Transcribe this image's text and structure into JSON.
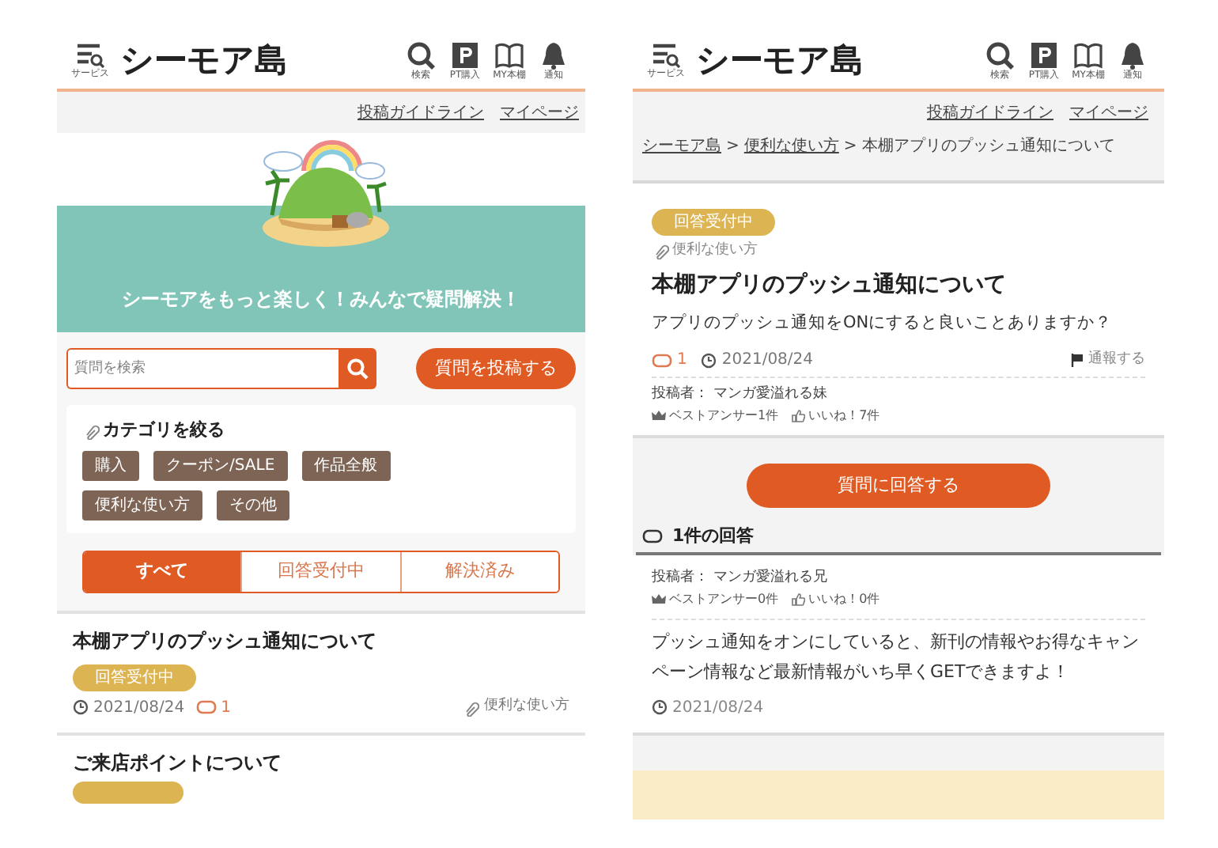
{
  "list_screen": {
    "header": {
      "service_label": "サービス",
      "logo": "シーモア島",
      "nav": [
        {
          "kind": "search",
          "label": "検索"
        },
        {
          "kind": "point",
          "label": "PT購入"
        },
        {
          "kind": "book",
          "label": "MY本棚"
        },
        {
          "kind": "bell",
          "label": "通知"
        }
      ]
    },
    "links": [
      "投稿ガイドライン",
      "マイページ"
    ],
    "banner": {
      "caption": "シーモアをもっと楽しく！みんなで疑問解決！"
    },
    "search": {
      "placeholder": "質問を検索"
    },
    "post_button": "質問を投稿する",
    "categories": {
      "title": "カテゴリを絞る",
      "tags": [
        "購入",
        "クーポン/SALE",
        "作品全般",
        "便利な使い方",
        "その他"
      ]
    },
    "filter_tabs": [
      {
        "label": "すべて",
        "selected": true
      },
      {
        "label": "回答受付中",
        "selected": false
      },
      {
        "label": "解決済み",
        "selected": false
      }
    ],
    "questions": [
      {
        "title": "本棚アプリのプッシュ通知について",
        "status": "回答受付中",
        "date": "2021/08/24",
        "comments": "1",
        "category": "便利な使い方"
      },
      {
        "title": "ご来店ポイントについて"
      }
    ]
  },
  "detail_screen": {
    "header": {
      "service_label": "サービス",
      "logo": "シーモア島",
      "nav": [
        {
          "kind": "search",
          "label": "検索"
        },
        {
          "kind": "point",
          "label": "PT購入"
        },
        {
          "kind": "book",
          "label": "MY本棚"
        },
        {
          "kind": "bell",
          "label": "通知"
        }
      ]
    },
    "links": [
      "投稿ガイドライン",
      "マイページ"
    ],
    "breadcrumb_separator": ">",
    "breadcrumb": [
      {
        "label": "シーモア島",
        "link": true
      },
      {
        "label": "便利な使い方",
        "link": true
      },
      {
        "label": "本棚アプリのプッシュ通知について",
        "link": false
      }
    ],
    "question": {
      "status": "回答受付中",
      "category": "便利な使い方",
      "title": "本棚アプリのプッシュ通知について",
      "body": "アプリのプッシュ通知をONにすると良いことありますか？",
      "comments": "1",
      "date": "2021/08/24",
      "report": "通報する"
    },
    "poster": {
      "name": "投稿者： マンガ愛溢れる妹",
      "best": "ベストアンサー1件",
      "likes": "いいね！7件"
    },
    "answer_button": "質問に回答する",
    "answers_heading": "1件の回答",
    "answers": [
      {
        "poster": {
          "name": "投稿者： マンガ愛溢れる兄",
          "best": "ベストアンサー0件",
          "likes": "いいね！0件"
        },
        "body": "プッシュ通知をオンにしていると、新刊の情報やお得なキャンペーン情報など最新情報がいち早くGETできますよ！",
        "date": "2021/08/24"
      }
    ]
  }
}
